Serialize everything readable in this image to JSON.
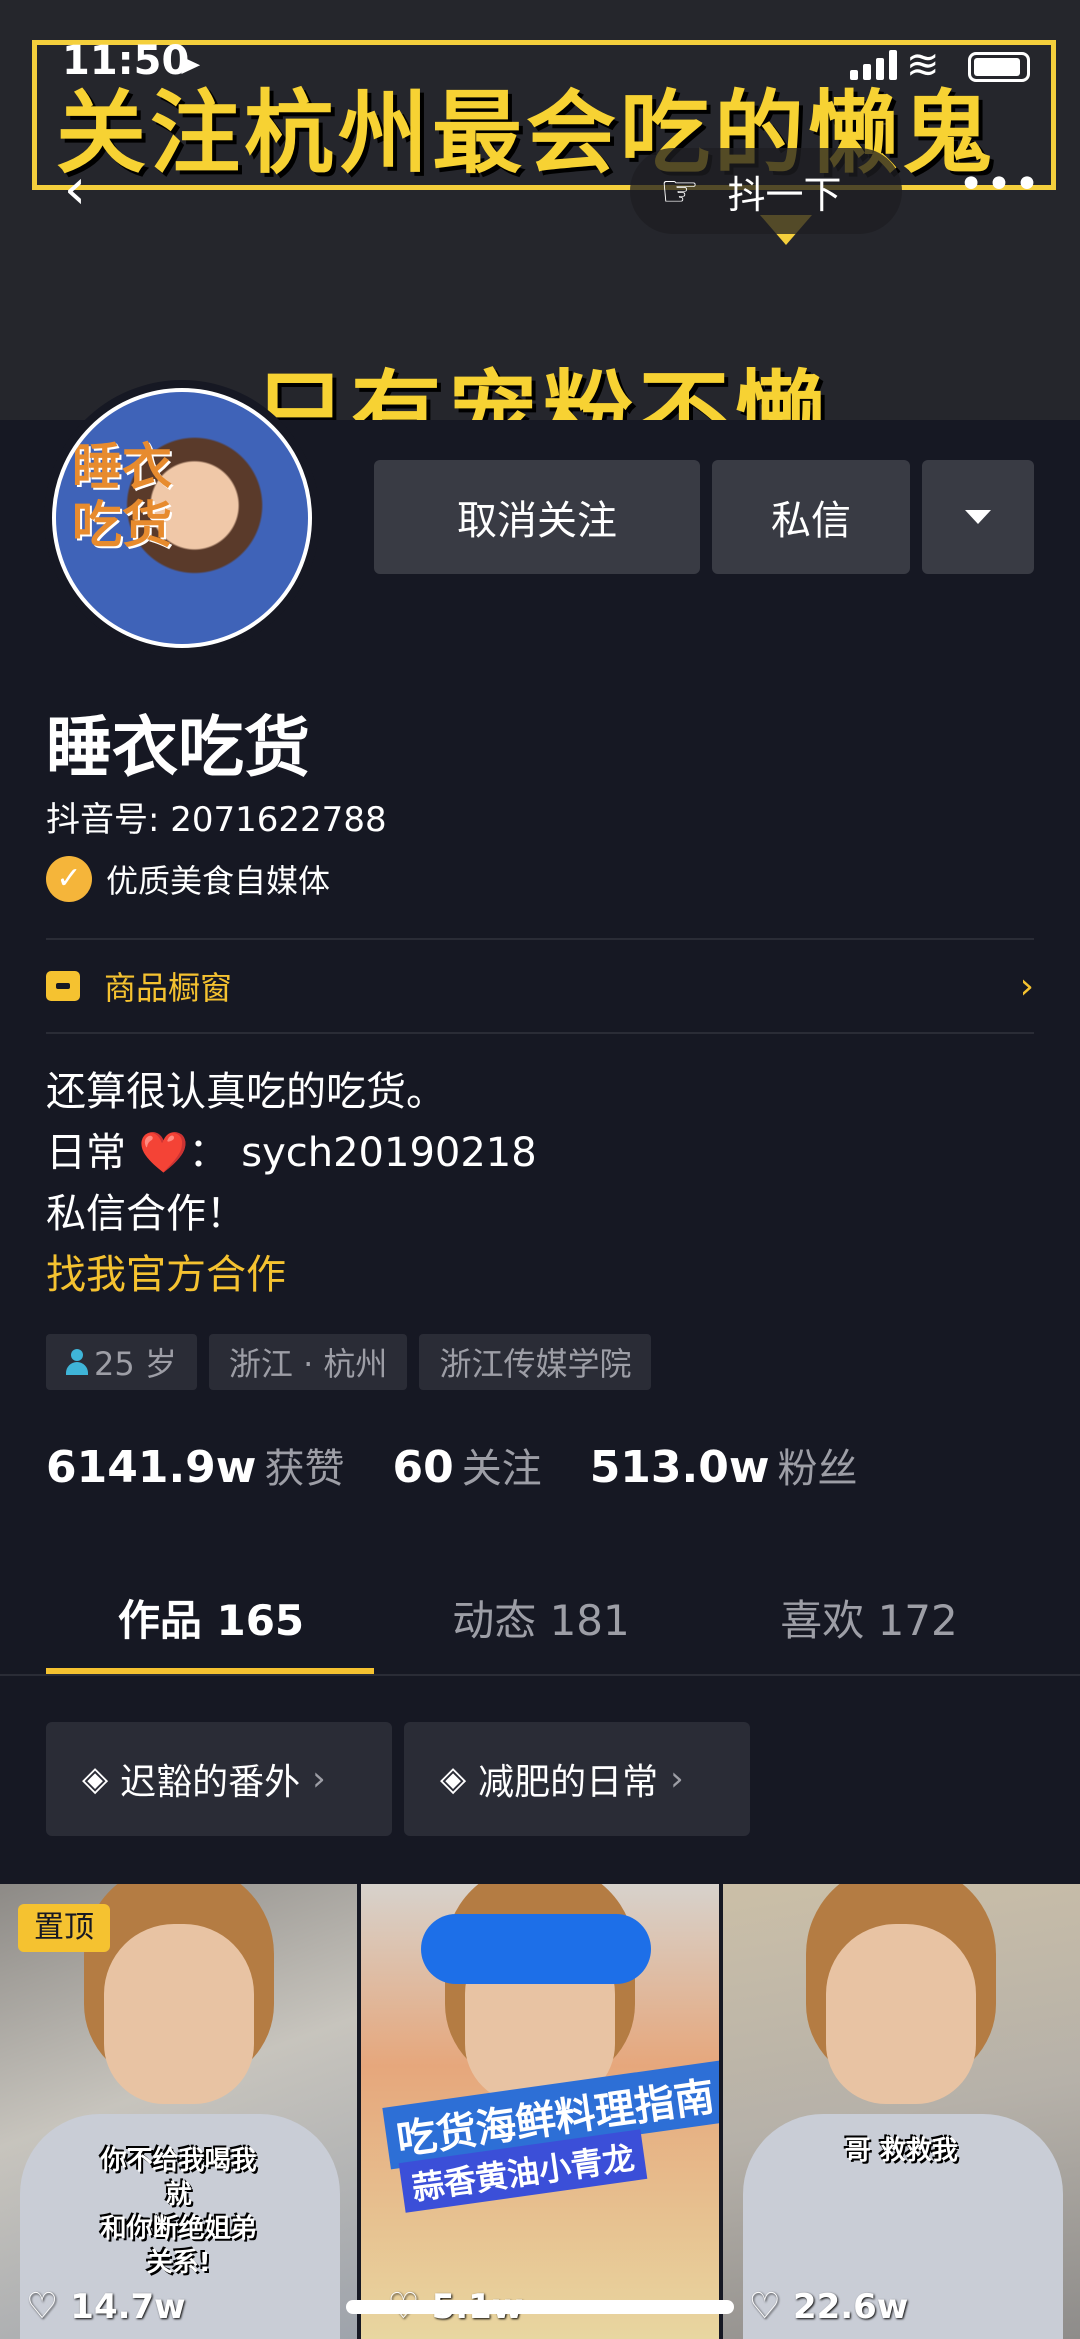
{
  "status_bar": {
    "time": "11:50",
    "location_icon": "location-arrow-icon"
  },
  "banner": {
    "line1": "关注杭州最会吃的懒鬼",
    "line2": "只有宠粉不懒"
  },
  "nav": {
    "shake_label": "抖一下"
  },
  "profile": {
    "avatar_text": "睡衣\n吃货",
    "name": "睡衣吃货",
    "douyin_id": "抖音号: 2071622788",
    "verification": "优质美食自媒体"
  },
  "actions": {
    "unfollow": "取消关注",
    "message": "私信"
  },
  "shop": {
    "label": "商品橱窗"
  },
  "bio": {
    "line1": "还算很认真吃的吃货。",
    "line2_prefix": "日常",
    "line2_heart": "❤️",
    "line2_suffix": "： sych20190218",
    "line3": "私信合作！",
    "link": "找我官方合作"
  },
  "tags": {
    "age": "25 岁",
    "location": "浙江 · 杭州",
    "school": "浙江传媒学院"
  },
  "stats": {
    "likes_value": "6141.9w",
    "likes_label": "获赞",
    "following_value": "60",
    "following_label": "关注",
    "fans_value": "513.0w",
    "fans_label": "粉丝"
  },
  "tabs": [
    {
      "label": "作品 165"
    },
    {
      "label": "动态 181"
    },
    {
      "label": "喜欢 172"
    }
  ],
  "playlists": [
    {
      "label": "迟豁的番外"
    },
    {
      "label": "减肥的日常"
    }
  ],
  "videos": [
    {
      "pinned": "置顶",
      "caption": "你不给我喝我就\n和你断绝姐弟关系!",
      "likes": "14.7w"
    },
    {
      "caption_title": "吃货海鲜料理指南",
      "caption_sub": "蒜香黄油小青龙",
      "likes": "5.1w"
    },
    {
      "caption": "哥 救救我",
      "likes": "22.6w"
    }
  ],
  "colors": {
    "background": "#161823",
    "accent": "#f5c230",
    "button": "#393b44"
  }
}
